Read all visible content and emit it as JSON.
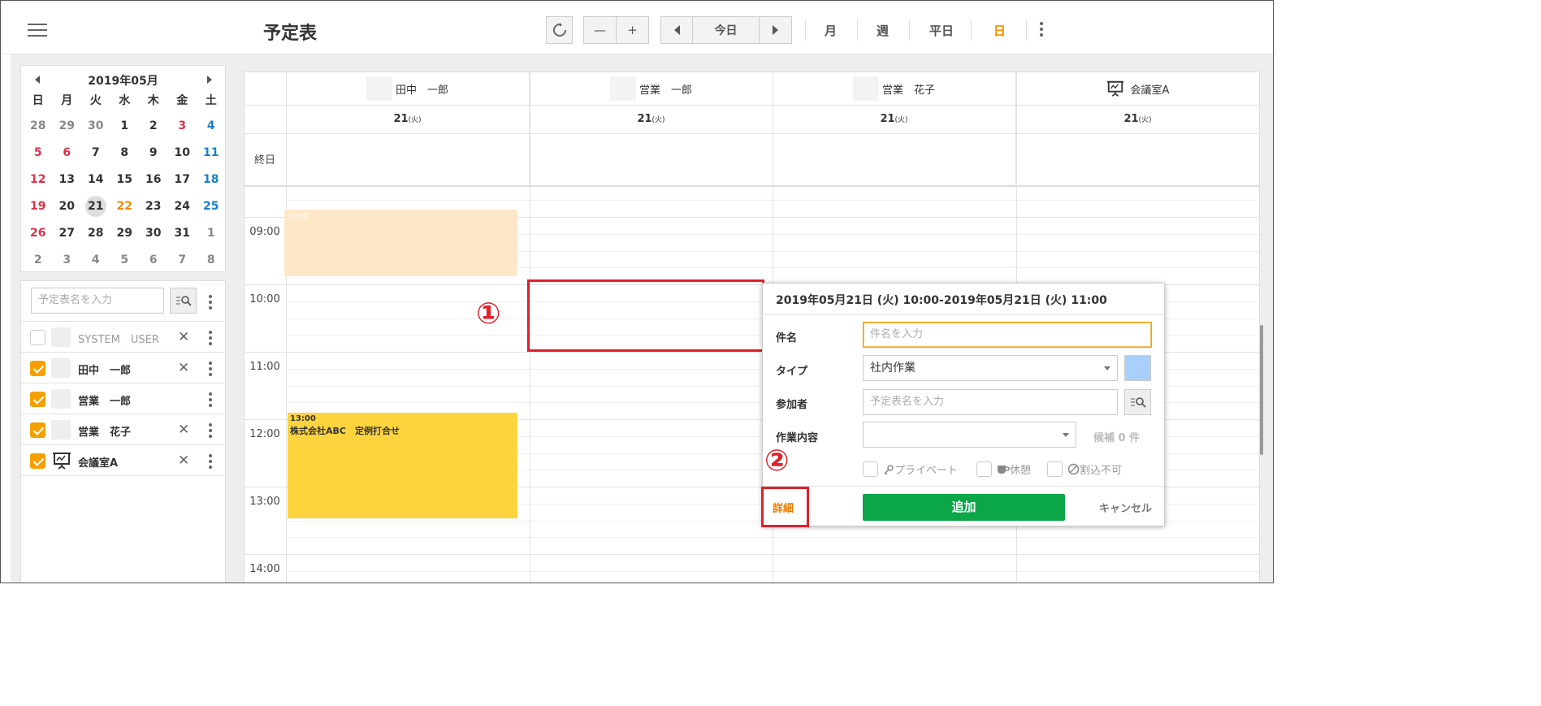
{
  "header": {
    "title": "予定表",
    "today_label": "今日",
    "minus_label": "—",
    "plus_label": "+",
    "views": [
      "月",
      "週",
      "平日",
      "日"
    ],
    "active_view": "日"
  },
  "mini_calendar": {
    "title": "2019年05月",
    "dow": [
      "日",
      "月",
      "火",
      "水",
      "木",
      "金",
      "土"
    ],
    "weeks": [
      [
        "28",
        "29",
        "30",
        "1",
        "2",
        "3",
        "4"
      ],
      [
        "5",
        "6",
        "7",
        "8",
        "9",
        "10",
        "11"
      ],
      [
        "12",
        "13",
        "14",
        "15",
        "16",
        "17",
        "18"
      ],
      [
        "19",
        "20",
        "21",
        "22",
        "23",
        "24",
        "25"
      ],
      [
        "26",
        "27",
        "28",
        "29",
        "30",
        "31",
        "1"
      ],
      [
        "2",
        "3",
        "4",
        "5",
        "6",
        "7",
        "8"
      ]
    ],
    "selected": "21"
  },
  "calendar_list": {
    "search_placeholder": "予定表名を入力",
    "items": [
      {
        "name": "SYSTEM　USER",
        "checked": false
      },
      {
        "name": "田中　一郎",
        "checked": true
      },
      {
        "name": "営業　一郎",
        "checked": true
      },
      {
        "name": "営業　花子",
        "checked": true
      },
      {
        "name": "会議室A",
        "checked": true
      }
    ]
  },
  "day_view": {
    "columns": [
      {
        "name": "田中　一郎",
        "date": "21",
        "dow": "(火)"
      },
      {
        "name": "営業　一郎",
        "date": "21",
        "dow": "(火)"
      },
      {
        "name": "営業　花子",
        "date": "21",
        "dow": "(火)"
      },
      {
        "name": "会議室A",
        "date": "21",
        "dow": "(火)"
      }
    ],
    "allday_label": "終日",
    "times": [
      "09:00",
      "10:00",
      "11:00",
      "12:00",
      "13:00",
      "14:00"
    ],
    "new_event": {
      "time": "10:00"
    },
    "existing_event": {
      "time": "13:00",
      "title": "株式会社ABC　定例打合せ"
    }
  },
  "annotations": {
    "one": "①",
    "two": "②"
  },
  "popup": {
    "title": "2019年05月21日 (火) 10:00-2019年05月21日 (火) 11:00",
    "subject_label": "件名",
    "subject_placeholder": "件名を入力",
    "type_label": "タイプ",
    "type_value": "社内作業",
    "type_color": "#a8d0fb",
    "participants_label": "参加者",
    "participants_placeholder": "予定表名を入力",
    "work_label": "作業内容",
    "candidates": "候補 0 件",
    "private_label": "プライベート",
    "break_label": "休憩",
    "no_interrupt_label": "割込不可",
    "detail_label": "詳細",
    "add_label": "追加",
    "cancel_label": "キャンセル"
  }
}
